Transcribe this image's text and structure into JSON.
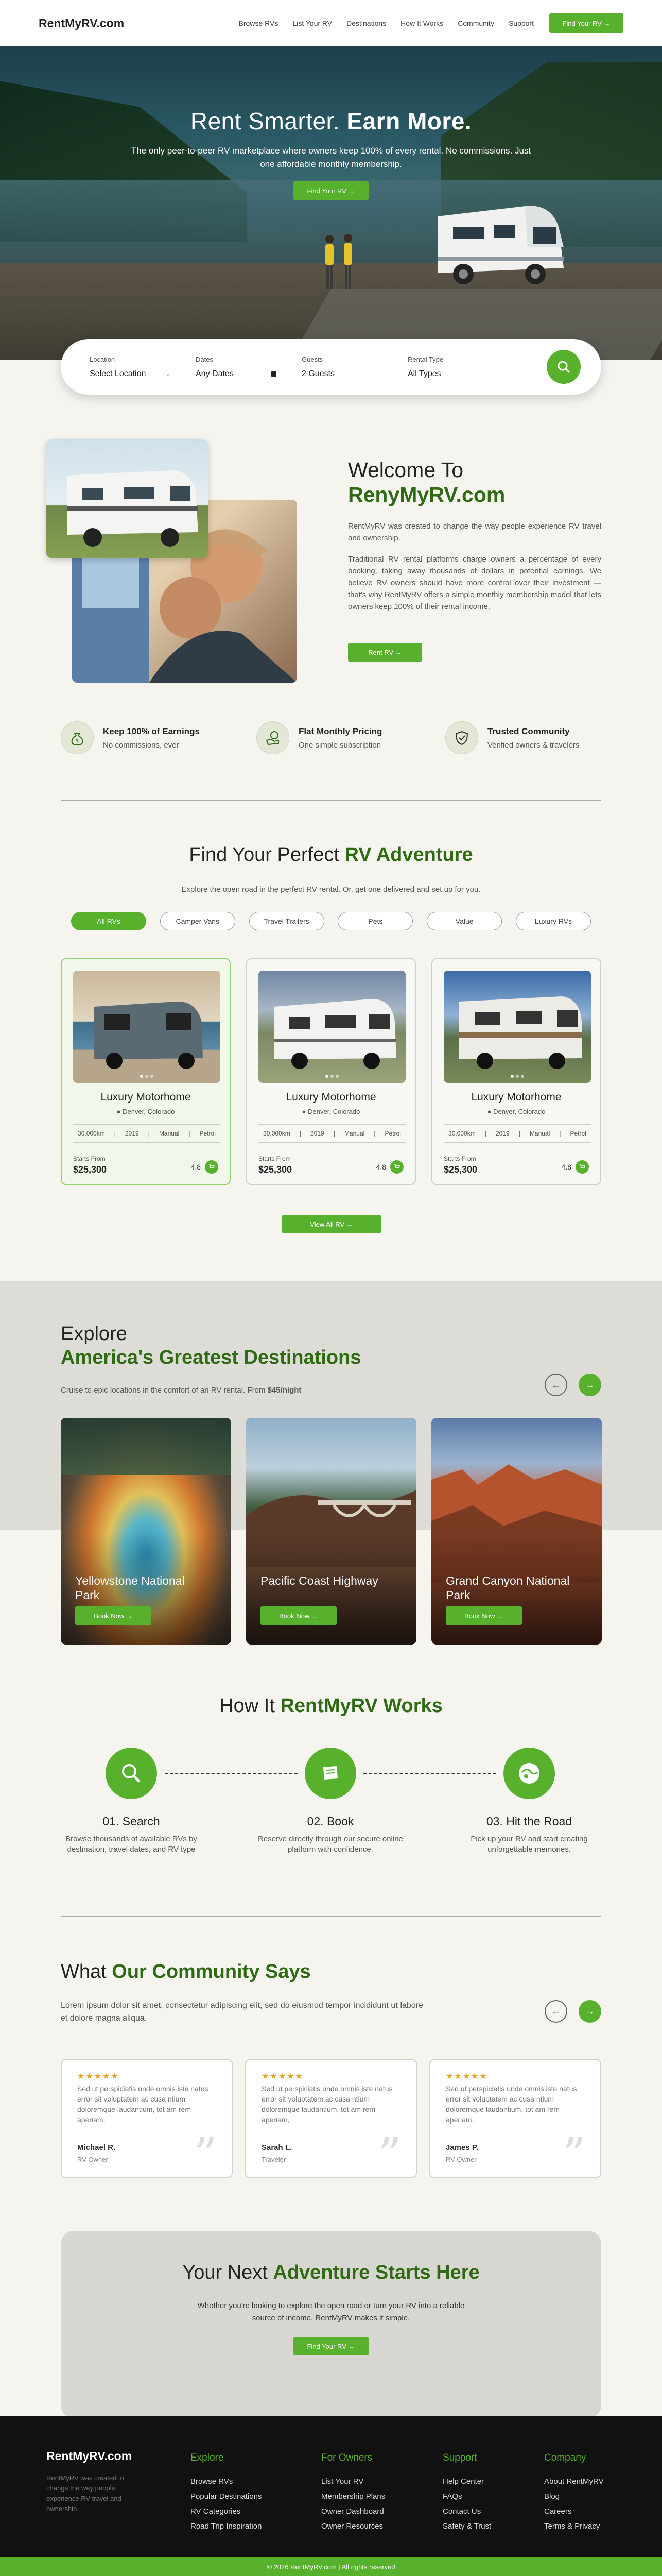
{
  "header": {
    "logo": "RentMyRV.com",
    "nav": [
      "Browse RVs",
      "List Your RV",
      "Destinations",
      "How It Works",
      "Community",
      "Support"
    ],
    "cta": "Find Your RV →"
  },
  "hero": {
    "title_light": "Rent Smarter.",
    "title_bold": "Earn More.",
    "subtitle": "The only peer-to-peer RV marketplace where owners keep 100% of every rental. No commissions. Just one affordable monthly membership.",
    "button": "Find Your RV →"
  },
  "search": {
    "location_label": "Location",
    "location_value": "Select Location",
    "dates_label": "Dates",
    "dates_value": "Any Dates",
    "guests_label": "Guests",
    "guests_value": "2 Guests",
    "type_label": "Rental Type",
    "type_value": "All Types"
  },
  "welcome": {
    "title_line1": "Welcome To",
    "title_line2": "RenyMyRV.com",
    "p1": "RentMyRV was created to change the way people experience RV travel and ownership.",
    "p2": "Traditional RV rental platforms charge owners a percentage of every booking, taking away thousands of dollars in potential earnings. We believe RV owners should have more control over their investment — that's why RentMyRV offers a simple monthly membership model that lets owners keep 100% of their rental income.",
    "button": "Rent RV →"
  },
  "features": [
    {
      "title": "Keep 100% of Earnings",
      "sub": "No commissions, ever",
      "icon": "money-bag-icon"
    },
    {
      "title": "Flat Monthly Pricing",
      "sub": "One simple subscription",
      "icon": "coins-icon"
    },
    {
      "title": "Trusted Community",
      "sub": "Verified owners & travelers",
      "icon": "shield-check-icon"
    }
  ],
  "adventure": {
    "title_light": "Find Your Perfect",
    "title_bold": "RV Adventure",
    "subtitle": "Explore the open road in the perfect RV rental. Or, get one delivered and set up for you.",
    "tabs": [
      "All RVs",
      "Camper Vans",
      "Travel Trailers",
      "Pets",
      "Value",
      "Luxury RVs"
    ],
    "cards": [
      {
        "name": "Luxury Motorhome",
        "location": "Denver, Colorado",
        "miles": "30,000km",
        "year": "2019",
        "trans": "Manual",
        "fuel": "Petrol",
        "from": "Starts From",
        "price": "$25,300",
        "rating": "4.8"
      },
      {
        "name": "Luxury Motorhome",
        "location": "Denver, Colorado",
        "miles": "30,000km",
        "year": "2019",
        "trans": "Manual",
        "fuel": "Petrol",
        "from": "Starts From",
        "price": "$25,300",
        "rating": "4.8"
      },
      {
        "name": "Luxury Motorhome",
        "location": "Denver, Colorado",
        "miles": "30,000km",
        "year": "2019",
        "trans": "Manual",
        "fuel": "Petrol",
        "from": "Starts From",
        "price": "$25,300",
        "rating": "4.8"
      }
    ],
    "view_all": "View All RV →"
  },
  "explore": {
    "title_light": "Explore",
    "title_bold": "America's Greatest Destinations",
    "subtitle_pre": "Cruise to epic locations in the comfort of an RV rental. From",
    "subtitle_price": "$45/night",
    "destinations": [
      {
        "name": "Yellowstone National Park",
        "button": "Book Now →"
      },
      {
        "name": "Pacific Coast Highway",
        "button": "Book Now →"
      },
      {
        "name": "Grand Canyon National Park",
        "button": "Book Now →"
      }
    ]
  },
  "how": {
    "title_light": "How It",
    "title_bold": "RentMyRV Works",
    "steps": [
      {
        "title": "01. Search",
        "desc": "Browse thousands of available RVs by destination, travel dates, and RV type"
      },
      {
        "title": "02. Book",
        "desc": "Reserve directly through our secure online platform with confidence."
      },
      {
        "title": "03. Hit the Road",
        "desc": "Pick up your RV and start creating unforgettable memories."
      }
    ]
  },
  "community": {
    "title_light": "What",
    "title_bold": "Our Community Says",
    "subtitle": "Lorem ipsum dolor sit amet, consectetur adipiscing elit, sed do eiusmod tempor incididunt ut labore et dolore magna aliqua.",
    "testimonials": [
      {
        "stars": "★★★★★",
        "text": "Sed ut perspiciatis unde omnis iste natus error sit voluptatem ac cusa ntium doloremque laudantium, tot am rem aperiam,",
        "name": "Michael R.",
        "role": "RV Owner"
      },
      {
        "stars": "★★★★★",
        "text": "Sed ut perspiciatis unde omnis iste natus error sit voluptatem ac cusa ntium doloremque laudantium, tot am rem aperiam,",
        "name": "Sarah L.",
        "role": "Traveler"
      },
      {
        "stars": "★★★★★",
        "text": "Sed ut perspiciatis unde omnis iste natus error sit voluptatem ac cusa ntium doloremque laudantium, tot am rem aperiam,",
        "name": "James P.",
        "role": "RV Owner"
      }
    ]
  },
  "cta": {
    "title_light": "Your Next",
    "title_bold": "Adventure Starts Here",
    "text": "Whether you're looking to explore the open road or turn your RV into a reliable source of income, RentMyRV makes it simple.",
    "button": "Find Your RV →"
  },
  "footer": {
    "logo": "RentMyRV.com",
    "about": "RentMyRV was created to change the way people experience RV travel and ownership.",
    "columns": [
      {
        "head": "Explore",
        "links": [
          "Browse RVs",
          "Popular Destinations",
          "RV Categories",
          "Road Trip Inspiration"
        ]
      },
      {
        "head": "For Owners",
        "links": [
          "List Your RV",
          "Membership Plans",
          "Owner Dashboard",
          "Owner Resources"
        ]
      },
      {
        "head": "Support",
        "links": [
          "Help Center",
          "FAQs",
          "Contact Us",
          "Safety & Trust"
        ]
      },
      {
        "head": "Company",
        "links": [
          "About RentMyRV",
          "Blog",
          "Careers",
          "Terms & Privacy"
        ]
      }
    ],
    "copyright": "© 2026 RentMyRV.com   |   All rights reserved"
  },
  "colors": {
    "accent": "#58b12d",
    "heading_green": "#2e6b12",
    "footer_bg": "#111111"
  }
}
